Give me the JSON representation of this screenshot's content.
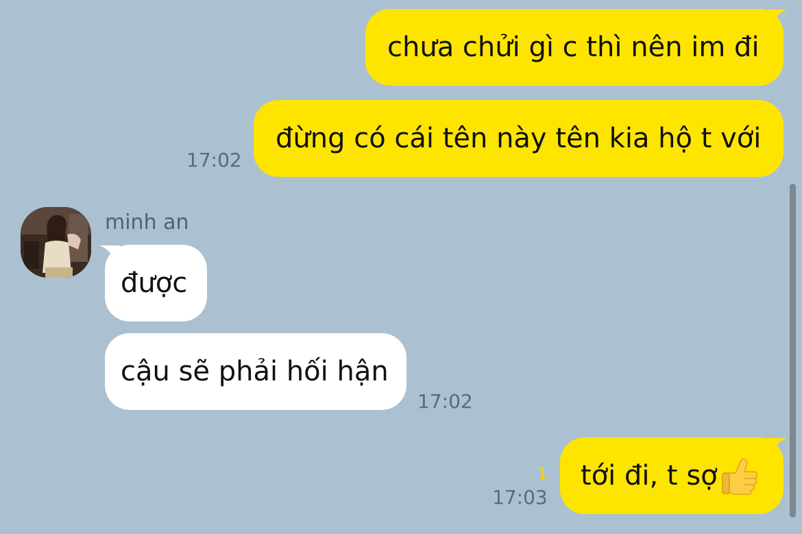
{
  "colors": {
    "background": "#abc1d1",
    "outgoing_bubble": "#fee500",
    "incoming_bubble": "#ffffff",
    "timestamp": "#5f6a74",
    "unread_count": "#f2d50f"
  },
  "messages": {
    "out_1": {
      "text": "chưa chửi gì c thì nên im đi"
    },
    "out_2": {
      "text": "đừng có cái tên này tên kia hộ t với",
      "time": "17:02"
    },
    "in_sender": "minh an",
    "in_1": {
      "text": "được"
    },
    "in_2": {
      "text": "cậu sẽ phải hối hận",
      "time": "17:02"
    },
    "out_3": {
      "text": "tới đi, t sợ",
      "emoji": "thumbs-up-icon",
      "time": "17:03",
      "unread": "1"
    }
  }
}
